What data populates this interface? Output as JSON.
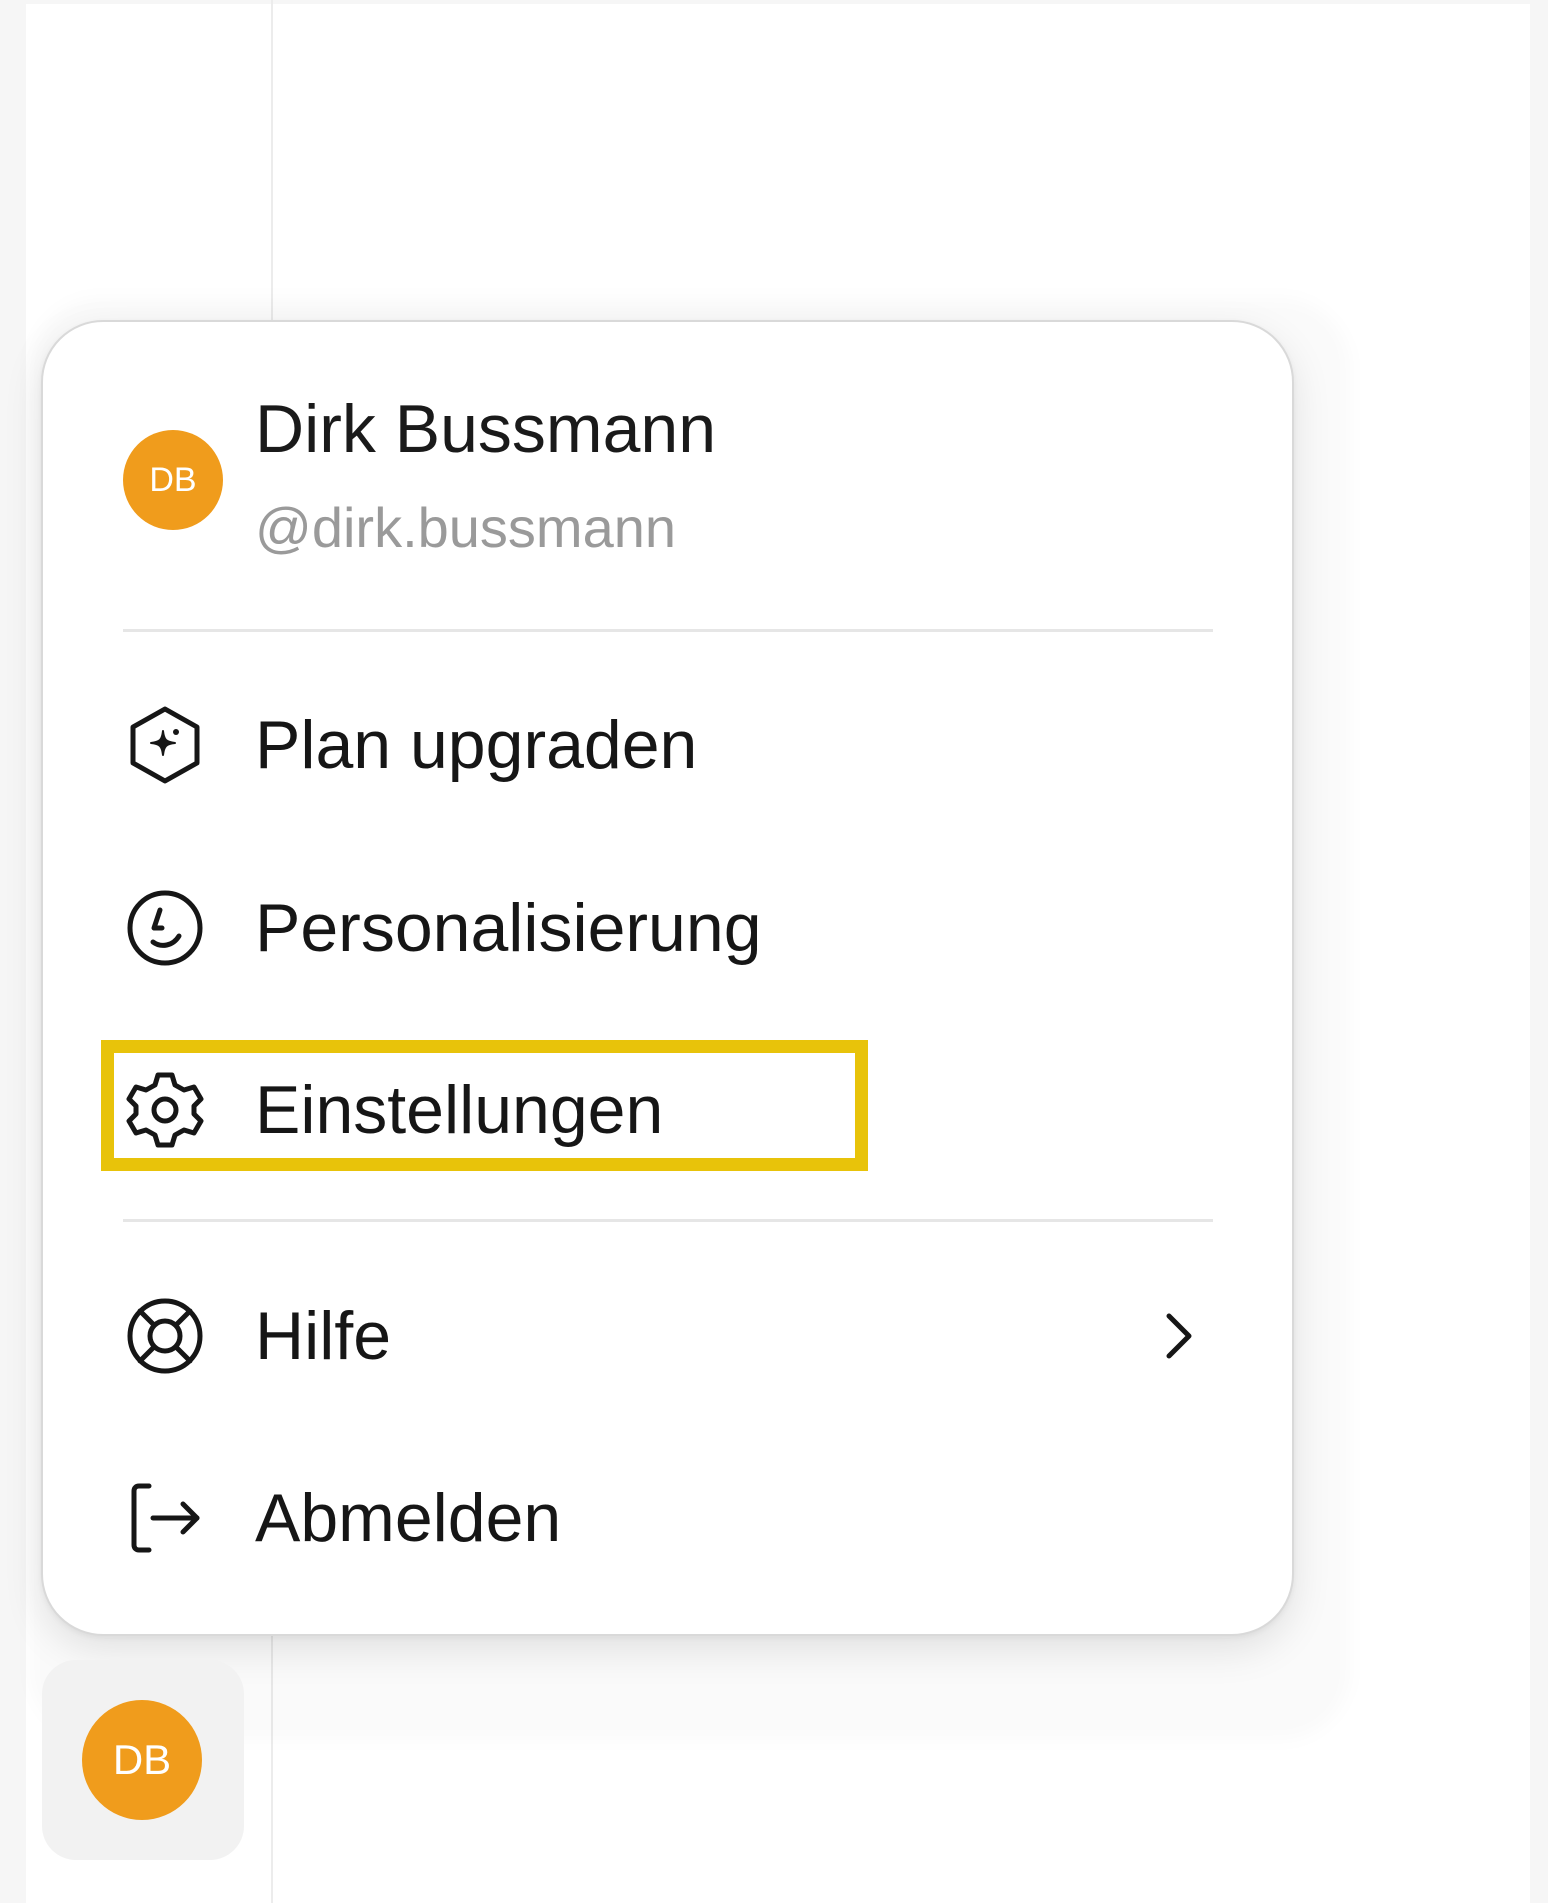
{
  "user": {
    "name": "Dirk Bussmann",
    "handle": "@dirk.bussmann",
    "initials": "DB"
  },
  "menu": {
    "items": [
      {
        "label": "Plan upgraden",
        "icon": "sparkle-hexagon-icon"
      },
      {
        "label": "Personalisierung",
        "icon": "smiley-circle-icon"
      },
      {
        "label": "Einstellungen",
        "icon": "gear-icon"
      },
      {
        "label": "Hilfe",
        "icon": "lifebuoy-icon",
        "submenu": true
      },
      {
        "label": "Abmelden",
        "icon": "logout-icon"
      }
    ]
  },
  "colors": {
    "avatar": "#f09c1c",
    "highlight": "#e8c30a",
    "handle_text": "#9a9a9a"
  }
}
